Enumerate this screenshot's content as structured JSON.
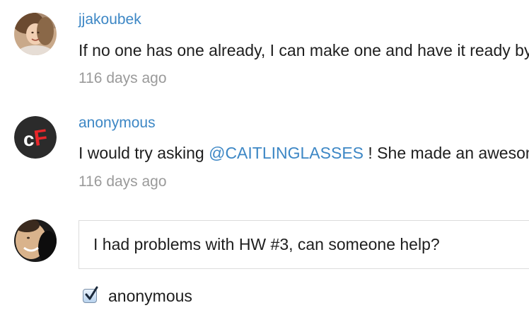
{
  "comments": [
    {
      "username": "jjakoubek",
      "text": "If no one has one already, I can make one and have it ready by",
      "time": "116 days ago",
      "avatar": "user-photo"
    },
    {
      "username": "anonymous",
      "text_before": "I would try asking ",
      "mention": "@CAITLINGLASSES",
      "text_after": " ! She made an awesome",
      "time": "116 days ago",
      "avatar": "cf-logo",
      "avatar_letters": {
        "c": "c",
        "f": "F"
      }
    }
  ],
  "reply": {
    "value": "I had problems with HW #3, can someone help?",
    "avatar": "user-photo",
    "anonymous_label": "anonymous",
    "anonymous_checked": true
  },
  "colors": {
    "link": "#3d87c5",
    "muted": "#9a9a9a",
    "text": "#1e1e1e",
    "cf_red": "#e8262a",
    "cf_dark": "#2b2b2b"
  }
}
